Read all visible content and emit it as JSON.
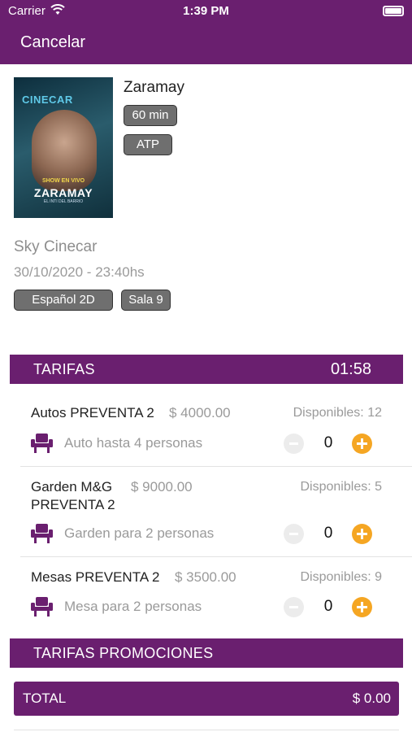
{
  "status_bar": {
    "carrier": "Carrier",
    "time": "1:39 PM"
  },
  "nav": {
    "cancel_label": "Cancelar"
  },
  "movie": {
    "title": "Zaramay",
    "duration": "60 min",
    "rating": "ATP",
    "poster": {
      "logo_text": "CINECAR",
      "tagline": "SHOW EN VIVO",
      "name": "ZARAMAY",
      "subtitle": "EL INTI DEL BARRIO"
    }
  },
  "cinema": "Sky Cinecar",
  "datetime": "30/10/2020 - 23:40hs",
  "language_format": "Español 2D",
  "room": "Sala 9",
  "tarifas": {
    "title": "TARIFAS",
    "timer": "01:58",
    "items": [
      {
        "name": "Autos PREVENTA 2",
        "price": "$ 4000.00",
        "available": "Disponibles: 12",
        "description": "Auto hasta 4 personas",
        "quantity": "0"
      },
      {
        "name": "Garden M&G PREVENTA 2",
        "price": "$ 9000.00",
        "available": "Disponibles: 5",
        "description": "Garden para 2 personas",
        "quantity": "0"
      },
      {
        "name": "Mesas PREVENTA 2",
        "price": "$ 3500.00",
        "available": "Disponibles: 9",
        "description": "Mesa para 2 personas",
        "quantity": "0"
      }
    ]
  },
  "promociones": {
    "title": "TARIFAS PROMOCIONES"
  },
  "total": {
    "label": "TOTAL",
    "value": "$ 0.00"
  },
  "colors": {
    "primary": "#6a1f6f",
    "accent": "#f5a623",
    "tag_bg": "#6f6f6f"
  }
}
